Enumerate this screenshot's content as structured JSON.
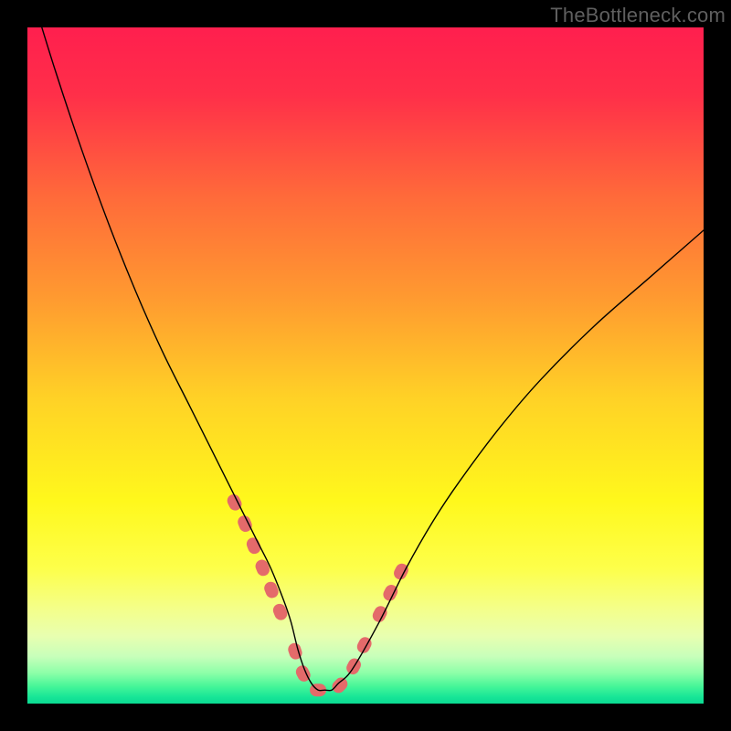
{
  "watermark": "TheBottleneck.com",
  "chart_data": {
    "type": "line",
    "title": "",
    "xlabel": "",
    "ylabel": "",
    "xlim": [
      0,
      100
    ],
    "ylim": [
      0,
      100
    ],
    "series": [
      {
        "name": "curve",
        "x": [
          0,
          4,
          8,
          12,
          16,
          20,
          24,
          28,
          30,
          32,
          34,
          36,
          38,
          39,
          40,
          41,
          42,
          43,
          44,
          45,
          46,
          48,
          52,
          56,
          60,
          64,
          70,
          76,
          84,
          92,
          100
        ],
        "y": [
          107,
          94,
          82,
          71,
          61,
          52,
          44,
          36,
          32,
          28,
          24,
          20,
          15,
          12,
          8,
          5,
          3,
          2,
          2,
          2,
          3,
          5,
          12,
          20,
          27,
          33,
          41,
          48,
          56,
          63,
          70
        ]
      }
    ],
    "highlight_segments": [
      {
        "x": [
          30.5,
          32,
          34,
          36,
          38
        ],
        "y": [
          30,
          27,
          22,
          17,
          12
        ]
      },
      {
        "x": [
          39.5,
          40.5,
          41.5,
          42.5,
          43.5,
          44.5,
          45.5,
          46.5,
          47.5,
          48.5,
          49.5,
          50.5
        ],
        "y": [
          8,
          5,
          3,
          2,
          2,
          2,
          2,
          3,
          4,
          6,
          8,
          10
        ]
      },
      {
        "x": [
          52,
          54,
          56
        ],
        "y": [
          13,
          17,
          21
        ]
      }
    ],
    "gradient_stops": [
      {
        "pos": 0.0,
        "color": "#ff1f4e"
      },
      {
        "pos": 0.1,
        "color": "#ff2f49"
      },
      {
        "pos": 0.25,
        "color": "#ff6a3a"
      },
      {
        "pos": 0.4,
        "color": "#ff9a30"
      },
      {
        "pos": 0.55,
        "color": "#ffd226"
      },
      {
        "pos": 0.7,
        "color": "#fff81c"
      },
      {
        "pos": 0.8,
        "color": "#fdff4a"
      },
      {
        "pos": 0.86,
        "color": "#f4ff8a"
      },
      {
        "pos": 0.9,
        "color": "#e8ffb0"
      },
      {
        "pos": 0.93,
        "color": "#c8ffba"
      },
      {
        "pos": 0.955,
        "color": "#8cffa8"
      },
      {
        "pos": 0.975,
        "color": "#44f598"
      },
      {
        "pos": 0.99,
        "color": "#17e697"
      },
      {
        "pos": 1.0,
        "color": "#0bd992"
      }
    ]
  }
}
